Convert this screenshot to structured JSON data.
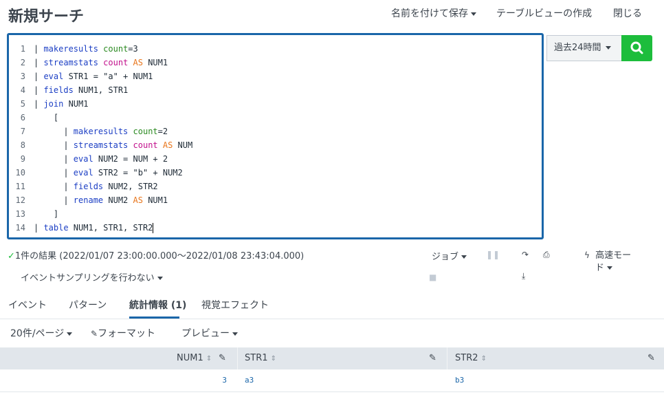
{
  "header": {
    "title": "新規サーチ",
    "save_as": "名前を付けて保存",
    "table_view": "テーブルビューの作成",
    "close": "閉じる"
  },
  "editor": {
    "lines": [
      {
        "num": "1",
        "tokens": [
          [
            "p",
            "| "
          ],
          [
            "cmd",
            "makeresults"
          ],
          [
            "p",
            " "
          ],
          [
            "arg",
            "count"
          ],
          [
            "p",
            "=3"
          ]
        ]
      },
      {
        "num": "2",
        "tokens": [
          [
            "p",
            "| "
          ],
          [
            "cmd",
            "streamstats"
          ],
          [
            "p",
            " "
          ],
          [
            "fn",
            "count"
          ],
          [
            "p",
            " "
          ],
          [
            "op",
            "AS"
          ],
          [
            "p",
            " NUM1"
          ]
        ]
      },
      {
        "num": "3",
        "tokens": [
          [
            "p",
            "| "
          ],
          [
            "cmd",
            "eval"
          ],
          [
            "p",
            " STR1 = \"a\" + NUM1"
          ]
        ]
      },
      {
        "num": "4",
        "tokens": [
          [
            "p",
            "| "
          ],
          [
            "cmd",
            "fields"
          ],
          [
            "p",
            " NUM1, STR1"
          ]
        ]
      },
      {
        "num": "5",
        "tokens": [
          [
            "p",
            "| "
          ],
          [
            "cmd",
            "join"
          ],
          [
            "p",
            " NUM1"
          ]
        ]
      },
      {
        "num": "6",
        "tokens": [
          [
            "p",
            "    ["
          ]
        ]
      },
      {
        "num": "7",
        "tokens": [
          [
            "p",
            "      | "
          ],
          [
            "cmd",
            "makeresults"
          ],
          [
            "p",
            " "
          ],
          [
            "arg",
            "count"
          ],
          [
            "p",
            "=2"
          ]
        ]
      },
      {
        "num": "8",
        "tokens": [
          [
            "p",
            "      | "
          ],
          [
            "cmd",
            "streamstats"
          ],
          [
            "p",
            " "
          ],
          [
            "fn",
            "count"
          ],
          [
            "p",
            " "
          ],
          [
            "op",
            "AS"
          ],
          [
            "p",
            " NUM"
          ]
        ]
      },
      {
        "num": "9",
        "tokens": [
          [
            "p",
            "      | "
          ],
          [
            "cmd",
            "eval"
          ],
          [
            "p",
            " NUM2 = NUM + 2"
          ]
        ]
      },
      {
        "num": "10",
        "tokens": [
          [
            "p",
            "      | "
          ],
          [
            "cmd",
            "eval"
          ],
          [
            "p",
            " STR2 = \"b\" + NUM2"
          ]
        ]
      },
      {
        "num": "11",
        "tokens": [
          [
            "p",
            "      | "
          ],
          [
            "cmd",
            "fields"
          ],
          [
            "p",
            " NUM2, STR2"
          ]
        ]
      },
      {
        "num": "12",
        "tokens": [
          [
            "p",
            "      | "
          ],
          [
            "cmd",
            "rename"
          ],
          [
            "p",
            " NUM2 "
          ],
          [
            "op",
            "AS"
          ],
          [
            "p",
            " NUM1"
          ]
        ]
      },
      {
        "num": "13",
        "tokens": [
          [
            "p",
            "    ]"
          ]
        ]
      },
      {
        "num": "14",
        "tokens": [
          [
            "p",
            "| "
          ],
          [
            "cmd",
            "table"
          ],
          [
            "p",
            " NUM1, STR1, STR2"
          ]
        ]
      }
    ]
  },
  "time_picker": {
    "label": "過去24時間"
  },
  "search_button": {
    "icon": "search-icon",
    "color": "#1dbd3c"
  },
  "status": {
    "result_text": "1件の結果 (2022/01/07 23:00:00.000〜2022/01/08 23:43:04.000)",
    "sampling": "イベントサンプリングを行わない"
  },
  "job_controls": {
    "job": "ジョブ",
    "mode_line1": "高速モー",
    "mode_line2": "ド"
  },
  "tabs": [
    {
      "label": "イベント"
    },
    {
      "label": "パターン"
    },
    {
      "label": "統計情報 (1)"
    },
    {
      "label": "視覚エフェクト"
    }
  ],
  "toolbar": {
    "per_page": "20件/ページ",
    "format": "フォーマット",
    "preview": "プレビュー"
  },
  "table": {
    "columns": [
      "NUM1",
      "STR1",
      "STR2"
    ],
    "rows": [
      [
        "3",
        "a3",
        "b3"
      ]
    ]
  },
  "colors": {
    "accent": "#1a66a9",
    "search_green": "#1dbd3c",
    "header_bg": "#e1e6eb"
  }
}
